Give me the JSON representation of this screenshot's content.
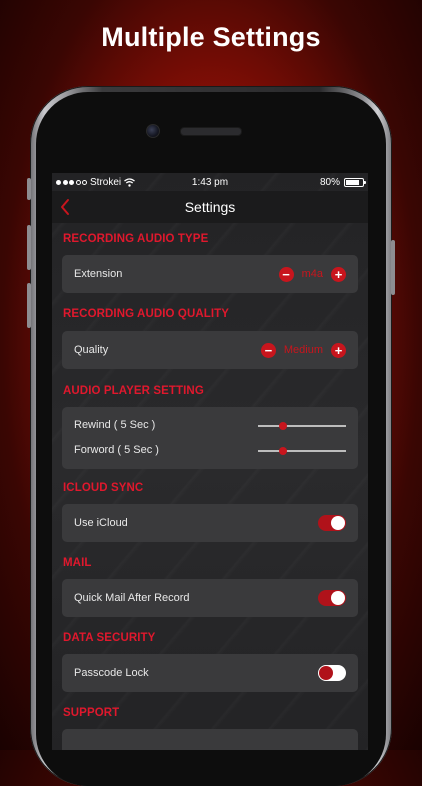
{
  "promo": {
    "headline": "Multiple Settings"
  },
  "status_bar": {
    "carrier": "Strokei",
    "time": "1:43 pm",
    "battery_text": "80%",
    "battery_level": 0.8
  },
  "nav": {
    "title": "Settings"
  },
  "sections": {
    "recording_type": {
      "title": "RECORDING AUDIO TYPE",
      "label": "Extension",
      "value": "m4a",
      "minus": "−",
      "plus": "+"
    },
    "recording_quality": {
      "title": "RECORDING AUDIO QUALITY",
      "label": "Quality",
      "value": "Medium",
      "minus": "−",
      "plus": "+"
    },
    "player": {
      "title": "AUDIO PLAYER SETTING",
      "rewind_label": "Rewind ( 5 Sec )",
      "rewind_level": 0.28,
      "forward_label": "Forword ( 5 Sec )",
      "forward_level": 0.28
    },
    "icloud": {
      "title": "ICLOUD SYNC",
      "label": "Use iCloud",
      "enabled": true
    },
    "mail": {
      "title": "MAIL",
      "label": "Quick Mail After Record",
      "enabled": true
    },
    "security": {
      "title": "DATA SECURITY",
      "label": "Passcode Lock",
      "enabled": false
    },
    "support": {
      "title": "SUPPORT"
    }
  },
  "icons": {
    "signal": "signal-dots-icon",
    "wifi": "wifi-icon",
    "battery": "battery-icon",
    "back": "chevron-left-icon",
    "camera": "camera-icon",
    "speaker": "speaker-grille-icon"
  },
  "colors": {
    "accent": "#e0182d",
    "toggle_on": "#b0121a",
    "card": "#3a3a3c",
    "nav": "#1b1b1c"
  }
}
